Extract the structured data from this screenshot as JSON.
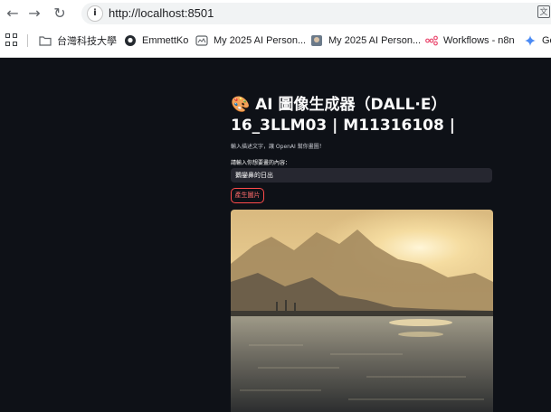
{
  "browser": {
    "url": "http://localhost:8501",
    "bookmarks": [
      {
        "label": "台灣科技大學",
        "icon": "folder-icon"
      },
      {
        "label": "EmmettKo",
        "icon": "github-icon"
      },
      {
        "label": "My 2025 AI Person...",
        "icon": "ai-person-icon"
      },
      {
        "label": "My 2025 AI Person...",
        "icon": "photo-icon"
      },
      {
        "label": "Workflows - n8n",
        "icon": "n8n-icon"
      },
      {
        "label": "Go",
        "icon": "gemini-icon"
      }
    ]
  },
  "app": {
    "title_emoji": "🎨",
    "title_line1": "AI 圖像生成器（DALL·E）",
    "title_line2": "16_3LLM03 | M11316108 |",
    "subtitle": "輸入描述文字，讓 OpenAI 幫你畫圖！",
    "input_label": "請輸入你想要畫的內容：",
    "input_value": "鵝鑾鼻的日出",
    "generate_button": "產生圖片",
    "image_alt": "sunrise over sea with mountains"
  },
  "colors": {
    "accent": "#ff4b4b",
    "background": "#0e1117",
    "input_bg": "#262730"
  }
}
